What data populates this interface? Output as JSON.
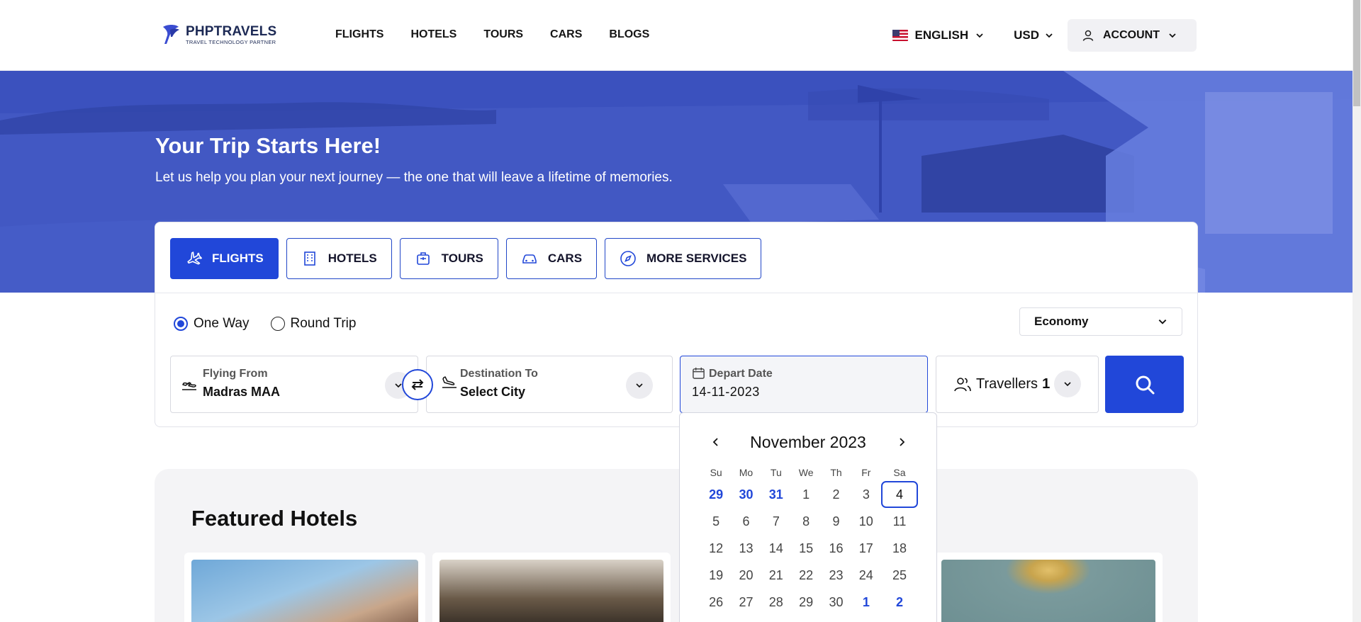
{
  "brand": {
    "name": "PHPTRAVELS",
    "tagline": "TRAVEL TECHNOLOGY PARTNER"
  },
  "nav": {
    "links": [
      "FLIGHTS",
      "HOTELS",
      "TOURS",
      "CARS",
      "BLOGS"
    ]
  },
  "header_right": {
    "language": "ENGLISH",
    "currency": "USD",
    "account": "ACCOUNT"
  },
  "hero": {
    "title": "Your Trip Starts Here!",
    "subtitle": "Let us help you plan your next journey — the one that will leave a lifetime of memories."
  },
  "search": {
    "tabs": [
      {
        "label": "FLIGHTS",
        "icon": "plane-icon",
        "active": true
      },
      {
        "label": "HOTELS",
        "icon": "building-icon",
        "active": false
      },
      {
        "label": "TOURS",
        "icon": "suitcase-icon",
        "active": false
      },
      {
        "label": "CARS",
        "icon": "car-icon",
        "active": false
      },
      {
        "label": "MORE SERVICES",
        "icon": "compass-icon",
        "active": false
      }
    ],
    "trip_type": {
      "one_way": "One Way",
      "round_trip": "Round Trip",
      "selected": "One Way"
    },
    "cabin": "Economy",
    "from": {
      "label": "Flying From",
      "value": "Madras MAA"
    },
    "to": {
      "label": "Destination To",
      "value": "Select City"
    },
    "depart": {
      "label": "Depart Date",
      "value": "14-11-2023"
    },
    "travellers": {
      "label": "Travellers",
      "count": "1"
    }
  },
  "calendar": {
    "month_label": "November 2023",
    "weekdays": [
      "Su",
      "Mo",
      "Tu",
      "We",
      "Th",
      "Fr",
      "Sa"
    ],
    "days": [
      {
        "d": "29",
        "other": true
      },
      {
        "d": "30",
        "other": true
      },
      {
        "d": "31",
        "other": true
      },
      {
        "d": "1"
      },
      {
        "d": "2"
      },
      {
        "d": "3"
      },
      {
        "d": "4",
        "selected": true
      },
      {
        "d": "5"
      },
      {
        "d": "6"
      },
      {
        "d": "7"
      },
      {
        "d": "8"
      },
      {
        "d": "9"
      },
      {
        "d": "10"
      },
      {
        "d": "11"
      },
      {
        "d": "12"
      },
      {
        "d": "13"
      },
      {
        "d": "14"
      },
      {
        "d": "15"
      },
      {
        "d": "16"
      },
      {
        "d": "17"
      },
      {
        "d": "18"
      },
      {
        "d": "19"
      },
      {
        "d": "20"
      },
      {
        "d": "21"
      },
      {
        "d": "22"
      },
      {
        "d": "23"
      },
      {
        "d": "24"
      },
      {
        "d": "25"
      },
      {
        "d": "26"
      },
      {
        "d": "27"
      },
      {
        "d": "28"
      },
      {
        "d": "29"
      },
      {
        "d": "30"
      },
      {
        "d": "1",
        "other": true
      },
      {
        "d": "2",
        "other": true
      }
    ]
  },
  "featured": {
    "title": "Featured Hotels"
  },
  "colors": {
    "primary": "#2147d9",
    "hero_tint": "#5b74d6",
    "text": "#111111"
  }
}
